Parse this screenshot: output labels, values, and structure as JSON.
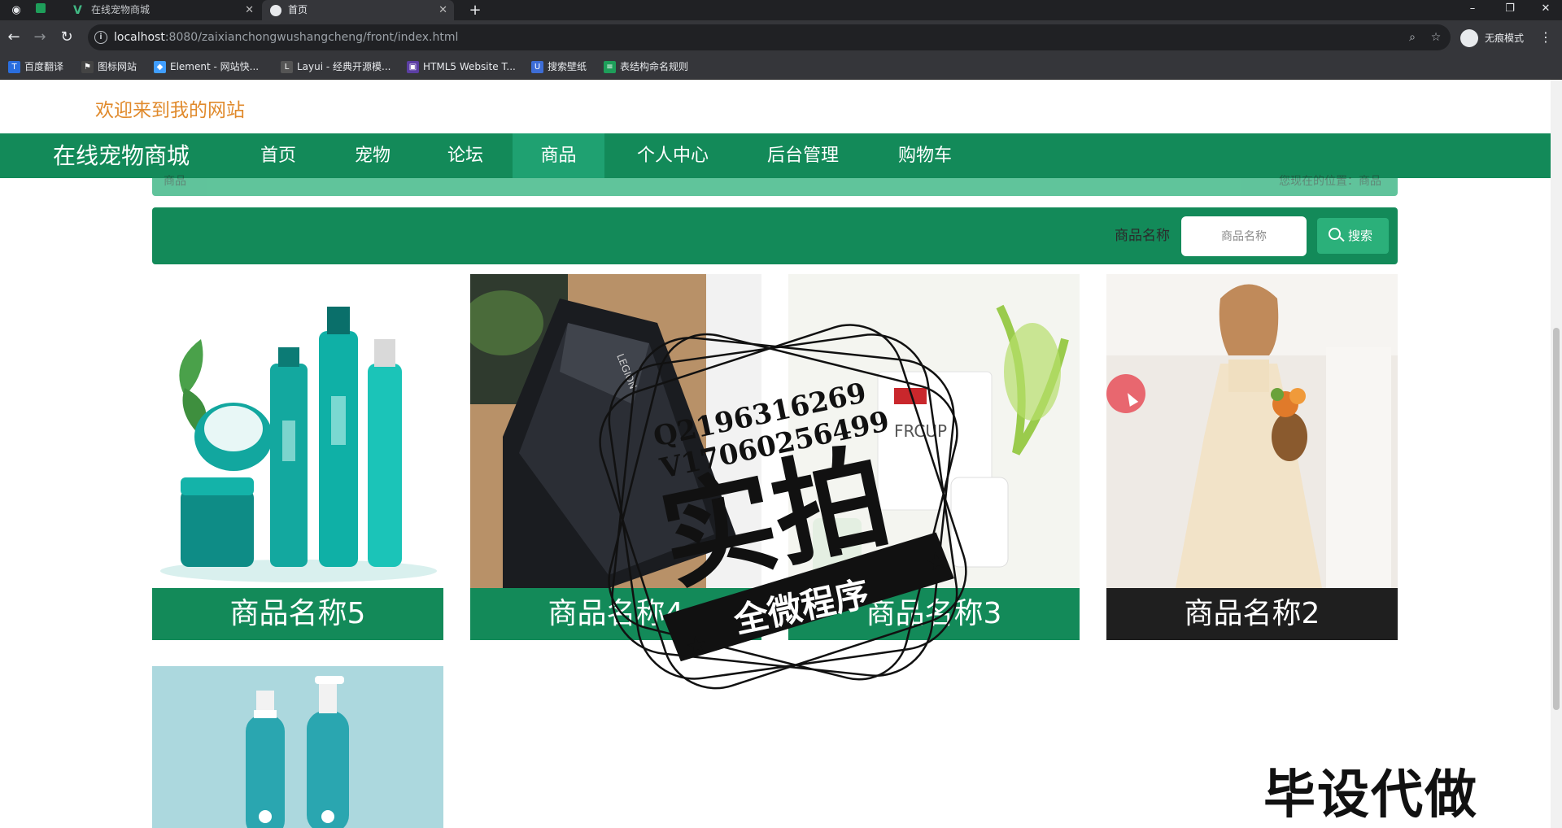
{
  "browser": {
    "tabs": [
      {
        "label": "在线宠物商城",
        "active": false
      },
      {
        "label": "首页",
        "active": true
      }
    ],
    "new_tab_glyph": "+",
    "url_host": "localhost",
    "url_path": ":8080/zaixianchongwushangcheng/front/index.html",
    "incognito_label": "无痕模式",
    "bookmarks": [
      {
        "label": "百度翻译",
        "icon_color": "#2a6ede"
      },
      {
        "label": "图标网站",
        "icon_color": "#444"
      },
      {
        "label": "Element - 网站快...",
        "icon_color": "#409eff"
      },
      {
        "label": "Layui - 经典开源模...",
        "icon_color": "#555"
      },
      {
        "label": "HTML5 Website T...",
        "icon_color": "#5b3ea3"
      },
      {
        "label": "搜索壁纸",
        "icon_color": "#3d6dd6"
      },
      {
        "label": "表结构命名规则",
        "icon_color": "#1e9e5a"
      }
    ]
  },
  "header": {
    "welcome": "欢迎来到我的网站"
  },
  "nav": {
    "brand": "在线宠物商城",
    "items": [
      "首页",
      "宠物",
      "论坛",
      "商品",
      "个人中心",
      "后台管理",
      "购物车"
    ],
    "active_index": 3
  },
  "breadcrumb": {
    "left": "商品",
    "right": "您现在的位置：商品"
  },
  "search": {
    "label": "商品名称",
    "placeholder": "商品名称",
    "button_label": "搜索"
  },
  "products": [
    {
      "name": "商品名称5",
      "image": "cosmetics-bottles-icon"
    },
    {
      "name": "商品名称4",
      "image": "laptop-icon"
    },
    {
      "name": "商品名称3",
      "image": "supplement-box-icon"
    },
    {
      "name": "商品名称2",
      "image": "woman-dress-icon"
    },
    {
      "name": "",
      "image": "pump-bottles-icon"
    }
  ],
  "watermark": {
    "qq": "Q2196316269",
    "vx": "V17060256499",
    "big": "实拍",
    "ribbon": "全微程序",
    "corner": "毕设代做"
  },
  "colors": {
    "primary": "#138a59",
    "accent": "#2bb07a",
    "welcome": "#e08a2c"
  }
}
